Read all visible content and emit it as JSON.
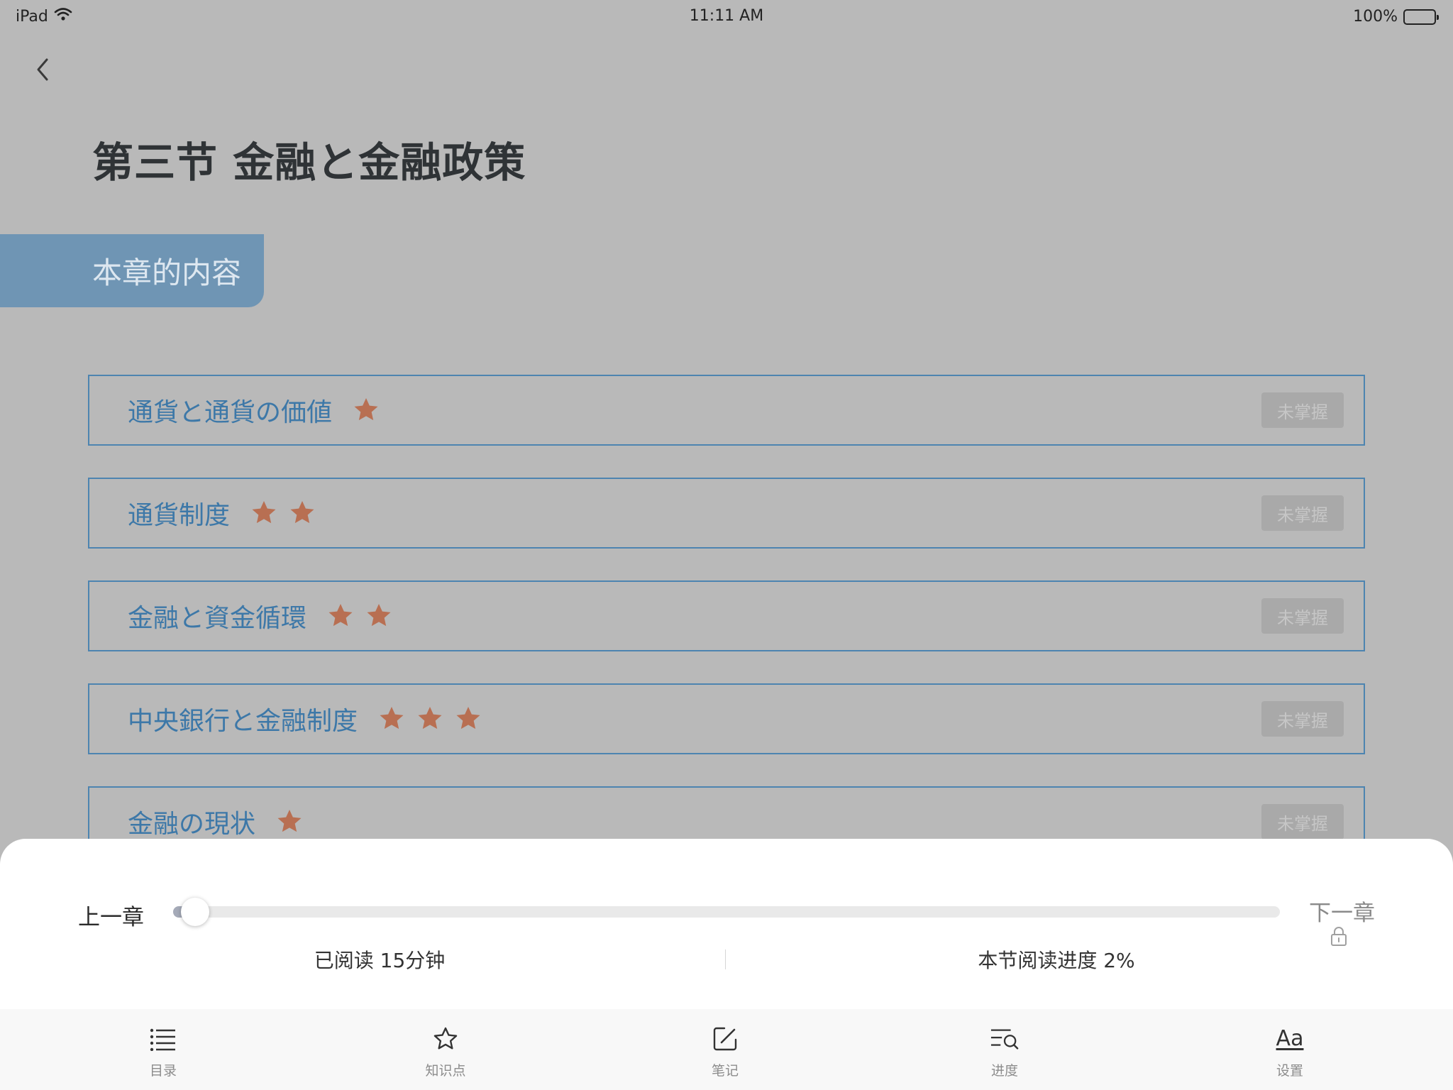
{
  "status_bar": {
    "device": "iPad",
    "time": "11:11 AM",
    "battery": "100%"
  },
  "header": {
    "back_icon": "chevron-left-icon",
    "title": "第三节 金融と金融政策"
  },
  "section_tab": {
    "label": "本章的内容"
  },
  "topics": [
    {
      "label": "通貨と通貨の価値",
      "stars": 1,
      "status": "未掌握"
    },
    {
      "label": "通貨制度",
      "stars": 2,
      "status": "未掌握"
    },
    {
      "label": "金融と資金循環",
      "stars": 2,
      "status": "未掌握"
    },
    {
      "label": "中央銀行と金融制度",
      "stars": 3,
      "status": "未掌握"
    },
    {
      "label": "金融の現状",
      "stars": 1,
      "status": "未掌握"
    }
  ],
  "reader_panel": {
    "prev_chapter": "上一章",
    "next_chapter": "下一章",
    "next_locked": true,
    "progress_percent": 2,
    "reading_time": "已阅读 15分钟",
    "section_progress": "本节阅读进度 2%"
  },
  "tab_bar": {
    "items": [
      {
        "label": "目录",
        "icon": "list-icon"
      },
      {
        "label": "知识点",
        "icon": "star-outline-icon"
      },
      {
        "label": "笔记",
        "icon": "edit-note-icon"
      },
      {
        "label": "进度",
        "icon": "search-list-icon"
      },
      {
        "label": "设置",
        "icon": "font-size-icon",
        "glyph": "Aa"
      }
    ]
  },
  "colors": {
    "overlay_background": "#b9b9b9",
    "accent_blue": "#3d78a8",
    "tab_blue": "#6f95b4",
    "star": "#b86f52",
    "badge_bg": "#a9a9a9"
  }
}
